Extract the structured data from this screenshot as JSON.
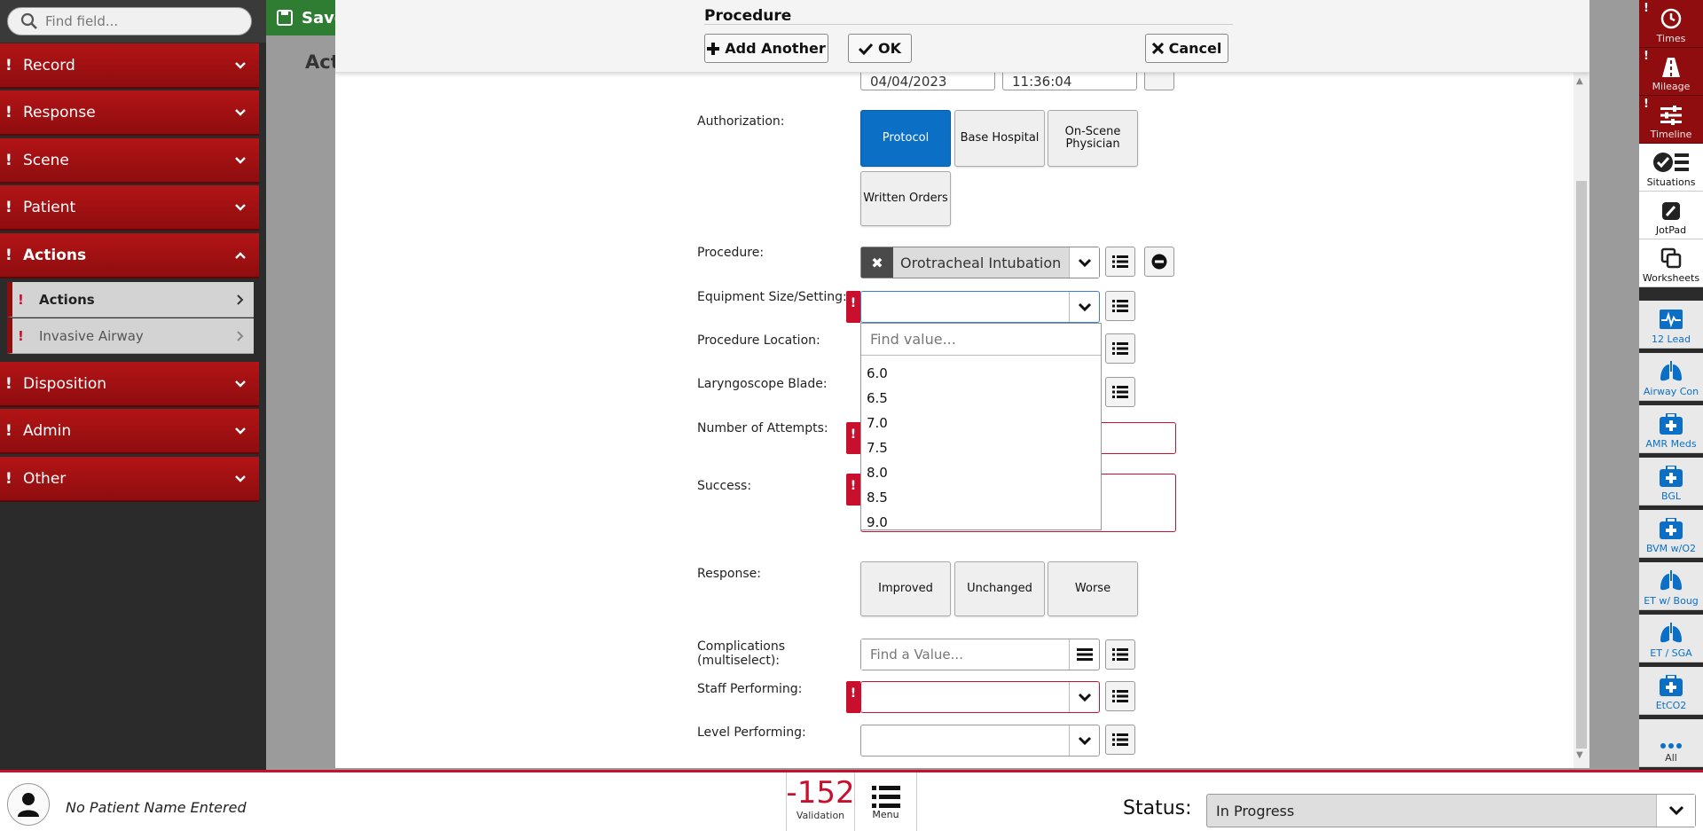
{
  "search": {
    "placeholder": "Find field..."
  },
  "toolbar": {
    "save_label": "Save"
  },
  "background": {
    "heading": "Act"
  },
  "sidebar": {
    "items": [
      {
        "label": "Record"
      },
      {
        "label": "Response"
      },
      {
        "label": "Scene"
      },
      {
        "label": "Patient"
      },
      {
        "label": "Actions"
      },
      {
        "label": "Disposition"
      },
      {
        "label": "Admin"
      },
      {
        "label": "Other"
      }
    ],
    "subitems": [
      {
        "label": "Actions"
      },
      {
        "label": "Invasive Airway"
      }
    ]
  },
  "modal": {
    "title": "Procedure",
    "add_another_label": "Add Another",
    "ok_label": "OK",
    "cancel_label": "Cancel",
    "date_value": "04/04/2023",
    "time_value": "11:36:04",
    "authorization": {
      "label": "Authorization:",
      "options": [
        "Protocol",
        "Base Hospital",
        "On-Scene Physician",
        "Written Orders"
      ],
      "selected": "Protocol"
    },
    "procedure": {
      "label": "Procedure:",
      "value": "Orotracheal Intubation"
    },
    "equipment": {
      "label": "Equipment Size/Setting:",
      "search_placeholder": "Find value...",
      "options": [
        "6.0",
        "6.5",
        "7.0",
        "7.5",
        "8.0",
        "8.5",
        "9.0"
      ]
    },
    "procedure_location": {
      "label": "Procedure Location:"
    },
    "laryngoscope": {
      "label": "Laryngoscope Blade:"
    },
    "attempts": {
      "label": "Number of Attempts:"
    },
    "success": {
      "label": "Success:"
    },
    "response": {
      "label": "Response:",
      "options": [
        "Improved",
        "Unchanged",
        "Worse"
      ]
    },
    "complications": {
      "label_line1": "Complications",
      "label_line2": "(multiselect):",
      "placeholder": "Find a Value..."
    },
    "staff": {
      "label": "Staff Performing:"
    },
    "level": {
      "label": "Level Performing:"
    }
  },
  "rail": {
    "items": [
      {
        "label": "Times",
        "icon": "clock-icon"
      },
      {
        "label": "Mileage",
        "icon": "road-icon"
      },
      {
        "label": "Timeline",
        "icon": "sliders-icon"
      },
      {
        "label": "Situations",
        "icon": "check-list-icon"
      },
      {
        "label": "JotPad",
        "icon": "pencil-icon"
      },
      {
        "label": "Worksheets",
        "icon": "copy-icon"
      },
      {
        "label": "12 Lead",
        "icon": "ecg-icon"
      },
      {
        "label": "Airway Con",
        "icon": "lungs-icon"
      },
      {
        "label": "AMR Meds",
        "icon": "medkit-icon"
      },
      {
        "label": "BGL",
        "icon": "medkit-icon"
      },
      {
        "label": "BVM w/O2",
        "icon": "medkit-icon"
      },
      {
        "label": "ET w/ Boug",
        "icon": "lungs-icon"
      },
      {
        "label": "ET / SGA",
        "icon": "lungs-icon"
      },
      {
        "label": "EtCO2",
        "icon": "medkit-icon"
      },
      {
        "label": "All",
        "icon": "ellipsis-icon"
      }
    ]
  },
  "bottom": {
    "patient_name": "No Patient Name Entered",
    "validation_count": "-152",
    "validation_label": "Validation",
    "menu_label": "Menu",
    "status_label": "Status:",
    "status_value": "In Progress"
  },
  "colors": {
    "brand_red": "#b31416",
    "selected_blue": "#0b6fc6",
    "error_red": "#c8102e"
  }
}
